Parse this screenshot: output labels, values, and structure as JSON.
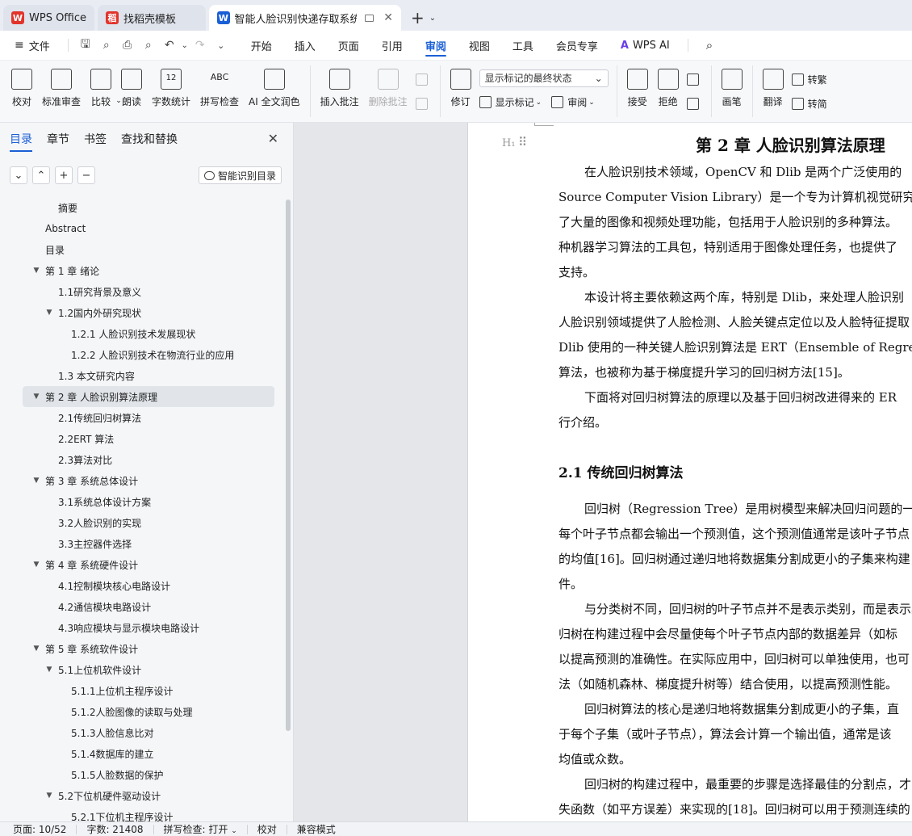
{
  "tabs": [
    {
      "label": "WPS Office",
      "logo": "W",
      "logo_color": "#e2342b",
      "active": false
    },
    {
      "label": "找稻壳模板",
      "logo": "稻",
      "logo_color": "#e2342b",
      "active": false
    },
    {
      "label": "智能人脸识别快递存取系统设",
      "logo": "W",
      "logo_color": "#1a5fd6",
      "active": true
    }
  ],
  "menubar": {
    "file_label": "文件",
    "items": [
      "开始",
      "插入",
      "页面",
      "引用",
      "审阅",
      "视图",
      "工具",
      "会员专享",
      "WPS AI"
    ],
    "active": "审阅"
  },
  "ribbon": {
    "buttons_left": [
      "校对",
      "标准审查",
      "比较",
      "朗读",
      "字数统计",
      "拼写检查",
      "AI 全文润色"
    ],
    "insert_comment": "插入批注",
    "delete_comment": "删除批注",
    "revise": "修订",
    "markup_dropdown": "显示标记的最终状态",
    "show_markup": "显示标记",
    "review": "审阅",
    "accept": "接受",
    "reject": "拒绝",
    "ink": "画笔",
    "translate": "翻译",
    "convert1": "转繁",
    "convert2": "转简"
  },
  "nav": {
    "tabs": [
      "目录",
      "章节",
      "书签",
      "查找和替换"
    ],
    "active_tab": "目录",
    "smart_toc": "智能识别目录",
    "toc": [
      {
        "label": "摘要",
        "level": 2,
        "arrow": ""
      },
      {
        "label": "Abstract",
        "level": 1,
        "arrow": ""
      },
      {
        "label": "目录",
        "level": 1,
        "arrow": ""
      },
      {
        "label": "第 1 章 绪论",
        "level": 1,
        "arrow": "▼"
      },
      {
        "label": "1.1研究背景及意义",
        "level": 2,
        "arrow": ""
      },
      {
        "label": "1.2国内外研究现状",
        "level": 2,
        "arrow": "▼"
      },
      {
        "label": "1.2.1 人脸识别技术发展现状",
        "level": 3,
        "arrow": ""
      },
      {
        "label": "1.2.2 人脸识别技术在物流行业的应用",
        "level": 3,
        "arrow": ""
      },
      {
        "label": "1.3 本文研究内容",
        "level": 2,
        "arrow": ""
      },
      {
        "label": "第 2 章 人脸识别算法原理",
        "level": 1,
        "arrow": "▼",
        "selected": true
      },
      {
        "label": "2.1传统回归树算法",
        "level": 2,
        "arrow": ""
      },
      {
        "label": "2.2ERT 算法",
        "level": 2,
        "arrow": ""
      },
      {
        "label": "2.3算法对比",
        "level": 2,
        "arrow": ""
      },
      {
        "label": "第 3 章 系统总体设计",
        "level": 1,
        "arrow": "▼"
      },
      {
        "label": "3.1系统总体设计方案",
        "level": 2,
        "arrow": ""
      },
      {
        "label": "3.2人脸识别的实现",
        "level": 2,
        "arrow": ""
      },
      {
        "label": "3.3主控器件选择",
        "level": 2,
        "arrow": ""
      },
      {
        "label": "第 4 章 系统硬件设计",
        "level": 1,
        "arrow": "▼"
      },
      {
        "label": "4.1控制模块核心电路设计",
        "level": 2,
        "arrow": ""
      },
      {
        "label": "4.2通信模块电路设计",
        "level": 2,
        "arrow": ""
      },
      {
        "label": "4.3响应模块与显示模块电路设计",
        "level": 2,
        "arrow": ""
      },
      {
        "label": "第 5 章 系统软件设计",
        "level": 1,
        "arrow": "▼"
      },
      {
        "label": "5.1上位机软件设计",
        "level": 2,
        "arrow": "▼"
      },
      {
        "label": "5.1.1上位机主程序设计",
        "level": 3,
        "arrow": ""
      },
      {
        "label": "5.1.2人脸图像的读取与处理",
        "level": 3,
        "arrow": ""
      },
      {
        "label": "5.1.3人脸信息比对",
        "level": 3,
        "arrow": ""
      },
      {
        "label": "5.1.4数据库的建立",
        "level": 3,
        "arrow": ""
      },
      {
        "label": "5.1.5人脸数据的保护",
        "level": 3,
        "arrow": ""
      },
      {
        "label": "5.2下位机硬件驱动设计",
        "level": 2,
        "arrow": "▼"
      },
      {
        "label": "5.2.1下位机主程序设计",
        "level": 3,
        "arrow": ""
      }
    ]
  },
  "document": {
    "chapter_title": "第 2 章  人脸识别算法原理",
    "lines": [
      {
        "t": "在人脸识别技术领域，OpenCV 和 Dlib 是两个广泛使用的",
        "indent": true
      },
      {
        "t": "Source Computer Vision Library）是一个专为计算机视觉研究所设",
        "indent": false
      },
      {
        "t": "了大量的图像和视频处理功能，包括用于人脸识别的多种算法。",
        "indent": false
      },
      {
        "t": "种机器学习算法的工具包，特别适用于图像处理任务，也提供了",
        "indent": false
      },
      {
        "t": "支持。",
        "indent": false
      },
      {
        "t": "本设计将主要依赖这两个库，特别是 Dlib，来处理人脸识别",
        "indent": true
      },
      {
        "t": "人脸识别领域提供了人脸检测、人脸关键点定位以及人脸特征提取",
        "indent": false
      },
      {
        "t": "Dlib 使用的一种关键人脸识别算法是 ERT（Ensemble of Regres",
        "indent": false
      },
      {
        "t": "算法，也被称为基于梯度提升学习的回归树方法[15]。",
        "indent": false
      },
      {
        "t": "下面将对回归树算法的原理以及基于回归树改进得来的 ER",
        "indent": true
      },
      {
        "t": "行介绍。",
        "indent": false
      }
    ],
    "section_title": "2.1  传统回归树算法",
    "lines2": [
      {
        "t": "回归树（Regression Tree）是用树模型来解决回归问题的一种",
        "indent": true
      },
      {
        "t": "每个叶子节点都会输出一个预测值，这个预测值通常是该叶子节点",
        "indent": false
      },
      {
        "t": "的均值[16]。回归树通过递归地将数据集分割成更小的子集来构建，",
        "indent": false
      },
      {
        "t": "件。",
        "indent": false
      },
      {
        "t": "与分类树不同，回归树的叶子节点并不是表示类别，而是表示具",
        "indent": true
      },
      {
        "t": "归树在构建过程中会尽量使每个叶子节点内部的数据差异（如标",
        "indent": false
      },
      {
        "t": "以提高预测的准确性。在实际应用中，回归树可以单独使用，也可",
        "indent": false
      },
      {
        "t": "法（如随机森林、梯度提升树等）结合使用，以提高预测性能。",
        "indent": false
      },
      {
        "t": "回归树算法的核心是递归地将数据集分割成更小的子集，直",
        "indent": true
      },
      {
        "t": "于每个子集（或叶子节点），算法会计算一个输出值，通常是该",
        "indent": false
      },
      {
        "t": "均值或众数。",
        "indent": false
      },
      {
        "t": "回归树的构建过程中，最重要的步骤是选择最佳的分割点，才",
        "indent": true
      },
      {
        "t": "失函数（如平方误差）来实现的[18]。回归树可以用于预测连续的",
        "indent": false
      }
    ]
  },
  "status": {
    "page": "页面: 10/52",
    "words": "字数: 21408",
    "spell": "拼写检查: 打开",
    "proof": "校对",
    "compat": "兼容模式"
  }
}
